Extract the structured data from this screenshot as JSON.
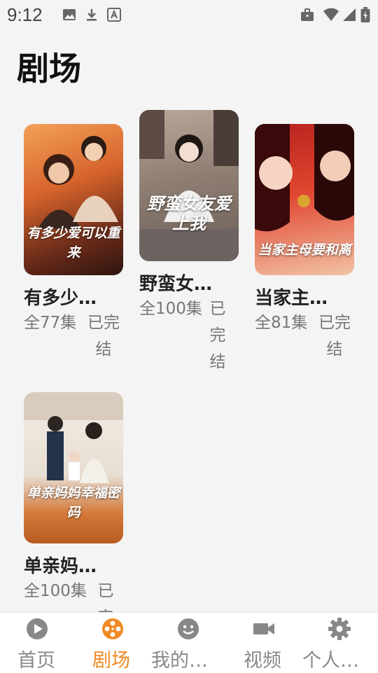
{
  "status_bar": {
    "time": "9:12",
    "left_icons": [
      "image-icon",
      "download-icon",
      "font-icon"
    ],
    "right_icons": [
      "briefcase-icon",
      "wifi-icon",
      "signal-icon",
      "battery-icon"
    ]
  },
  "page": {
    "title": "剧场"
  },
  "dramas": [
    {
      "title": "有多少…",
      "episodes": "全77集",
      "status": "已完结",
      "poster_text": "有多少爱可以重来"
    },
    {
      "title": "野蛮女…",
      "episodes": "全100集",
      "status": "已完结",
      "poster_text": "野蛮女友爱上我"
    },
    {
      "title": "当家主…",
      "episodes": "全81集",
      "status": "已完结",
      "poster_text": "当家主母要和离"
    },
    {
      "title": "单亲妈…",
      "episodes": "全100集",
      "status": "已完结",
      "poster_text": "单亲妈妈幸福密码"
    }
  ],
  "bottom_nav": [
    {
      "label": "首页",
      "icon": "play-circle-icon",
      "active": false
    },
    {
      "label": "剧场",
      "icon": "film-reel-icon",
      "active": true
    },
    {
      "label": "我的…",
      "icon": "smile-icon",
      "active": false
    },
    {
      "label": "视频",
      "icon": "video-camera-icon",
      "active": false
    },
    {
      "label": "个人…",
      "icon": "gear-icon",
      "active": false
    }
  ],
  "colors": {
    "accent": "#f08a24",
    "inactive": "#888888",
    "background": "#f4f4f4"
  }
}
